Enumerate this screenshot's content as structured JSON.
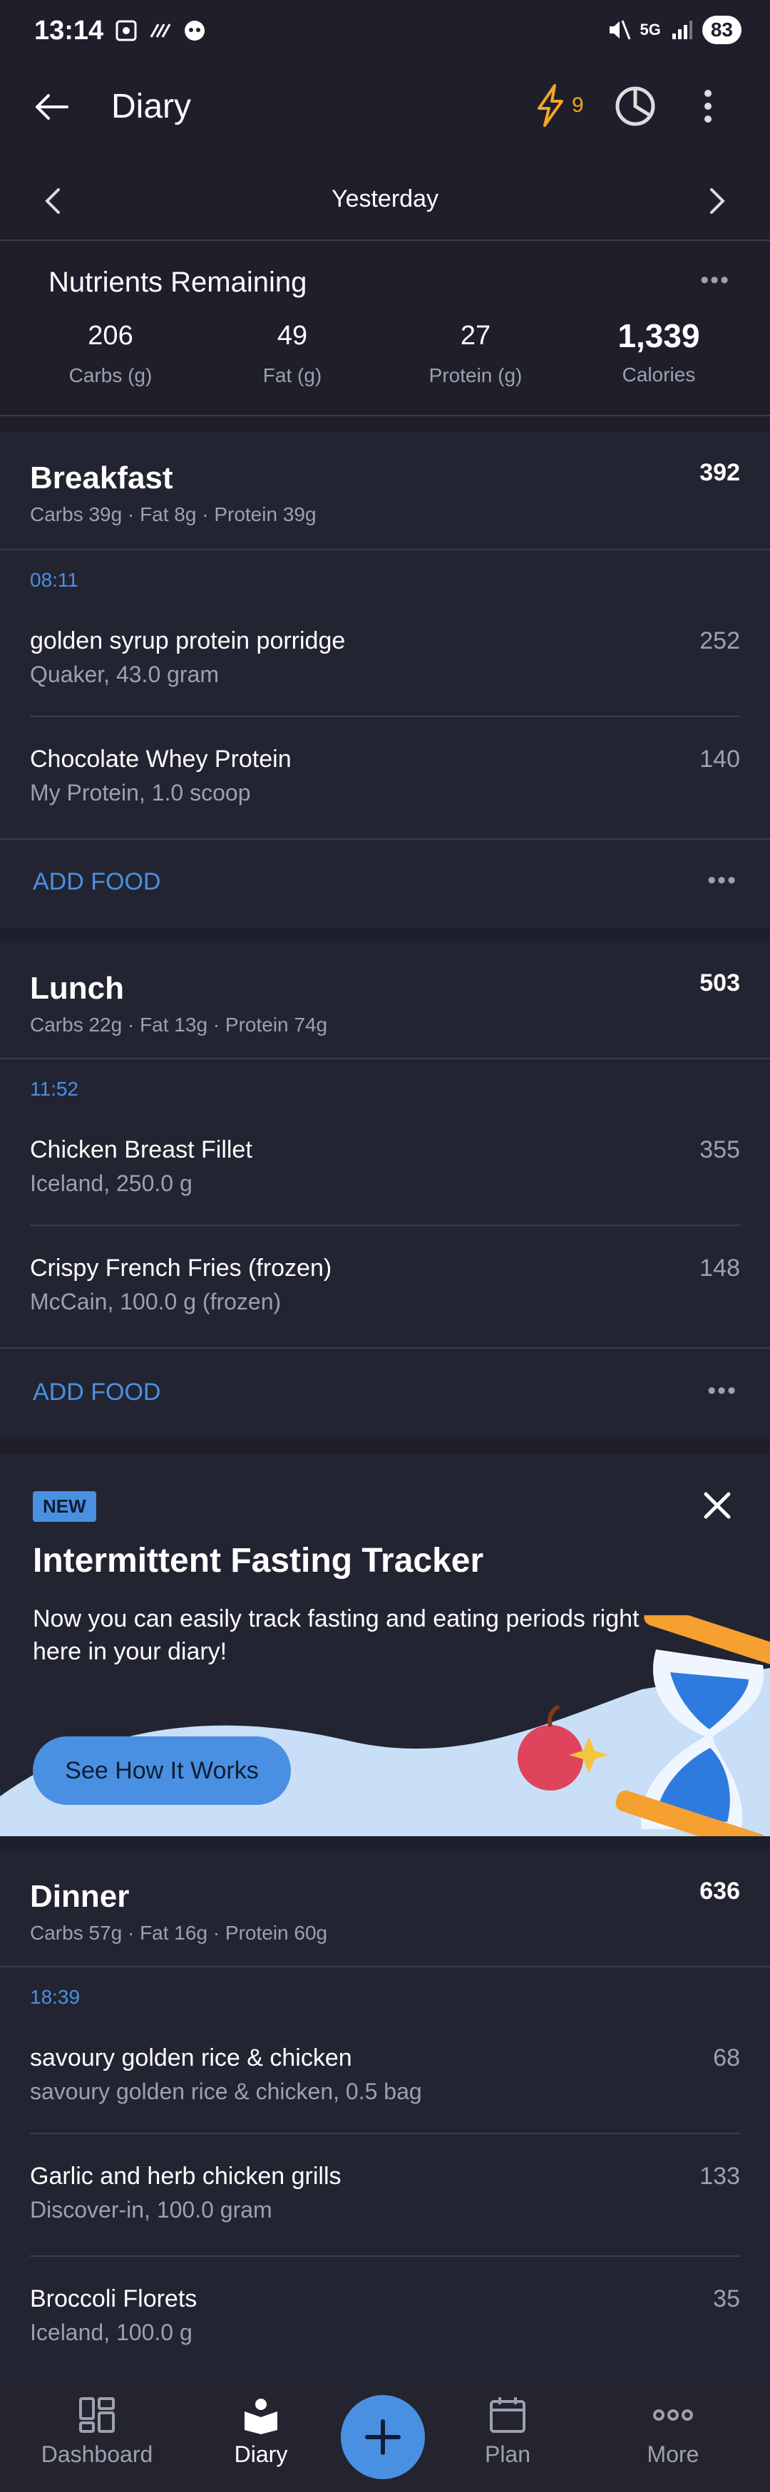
{
  "status": {
    "time": "13:14",
    "battery": "83",
    "network": "5G"
  },
  "header": {
    "title": "Diary",
    "streak_count": "9"
  },
  "date_nav": {
    "label": "Yesterday"
  },
  "nutrients": {
    "title": "Nutrients Remaining",
    "columns": [
      {
        "value": "206",
        "label": "Carbs (g)"
      },
      {
        "value": "49",
        "label": "Fat (g)"
      },
      {
        "value": "27",
        "label": "Protein (g)"
      },
      {
        "value": "1,339",
        "label": "Calories"
      }
    ]
  },
  "meals": [
    {
      "name": "Breakfast",
      "calories": "392",
      "macros": "Carbs 39g · Fat 8g · Protein 39g",
      "time": "08:11",
      "items": [
        {
          "name": "golden syrup protein porridge",
          "detail": "Quaker, 43.0 gram",
          "calories": "252"
        },
        {
          "name": "Chocolate Whey Protein",
          "detail": "My Protein, 1.0 scoop",
          "calories": "140"
        }
      ],
      "add_label": "ADD FOOD"
    },
    {
      "name": "Lunch",
      "calories": "503",
      "macros": "Carbs 22g · Fat 13g · Protein 74g",
      "time": "11:52",
      "items": [
        {
          "name": "Chicken  Breast Fillet",
          "detail": "Iceland, 250.0 g",
          "calories": "355"
        },
        {
          "name": "Crispy French Fries (frozen)",
          "detail": "McCain, 100.0 g (frozen)",
          "calories": "148"
        }
      ],
      "add_label": "ADD FOOD"
    },
    {
      "name": "Dinner",
      "calories": "636",
      "macros": "Carbs 57g · Fat 16g · Protein 60g",
      "time": "18:39",
      "items": [
        {
          "name": "savoury golden rice & chicken",
          "detail": "savoury golden rice & chicken, 0.5 bag",
          "calories": "68"
        },
        {
          "name": "Garlic and herb chicken grills",
          "detail": "Discover-in, 100.0 gram",
          "calories": "133"
        },
        {
          "name": "Broccoli Florets",
          "detail": "Iceland, 100.0 g",
          "calories": "35"
        }
      ]
    }
  ],
  "promo": {
    "badge": "NEW",
    "title": "Intermittent Fasting Tracker",
    "text": "Now you can easily track fasting and eating periods right here in your diary!",
    "cta": "See How It Works"
  },
  "bottom_nav": [
    {
      "label": "Dashboard",
      "icon": "dashboard-icon"
    },
    {
      "label": "Diary",
      "icon": "diary-icon"
    },
    {
      "label": "Plan",
      "icon": "calendar-icon"
    },
    {
      "label": "More",
      "icon": "more-icon"
    }
  ],
  "colors": {
    "background": "#1e1f2b",
    "card": "#232431",
    "accent": "#4a90e2",
    "streak": "#f5a623",
    "muted": "#9ea0ad"
  }
}
